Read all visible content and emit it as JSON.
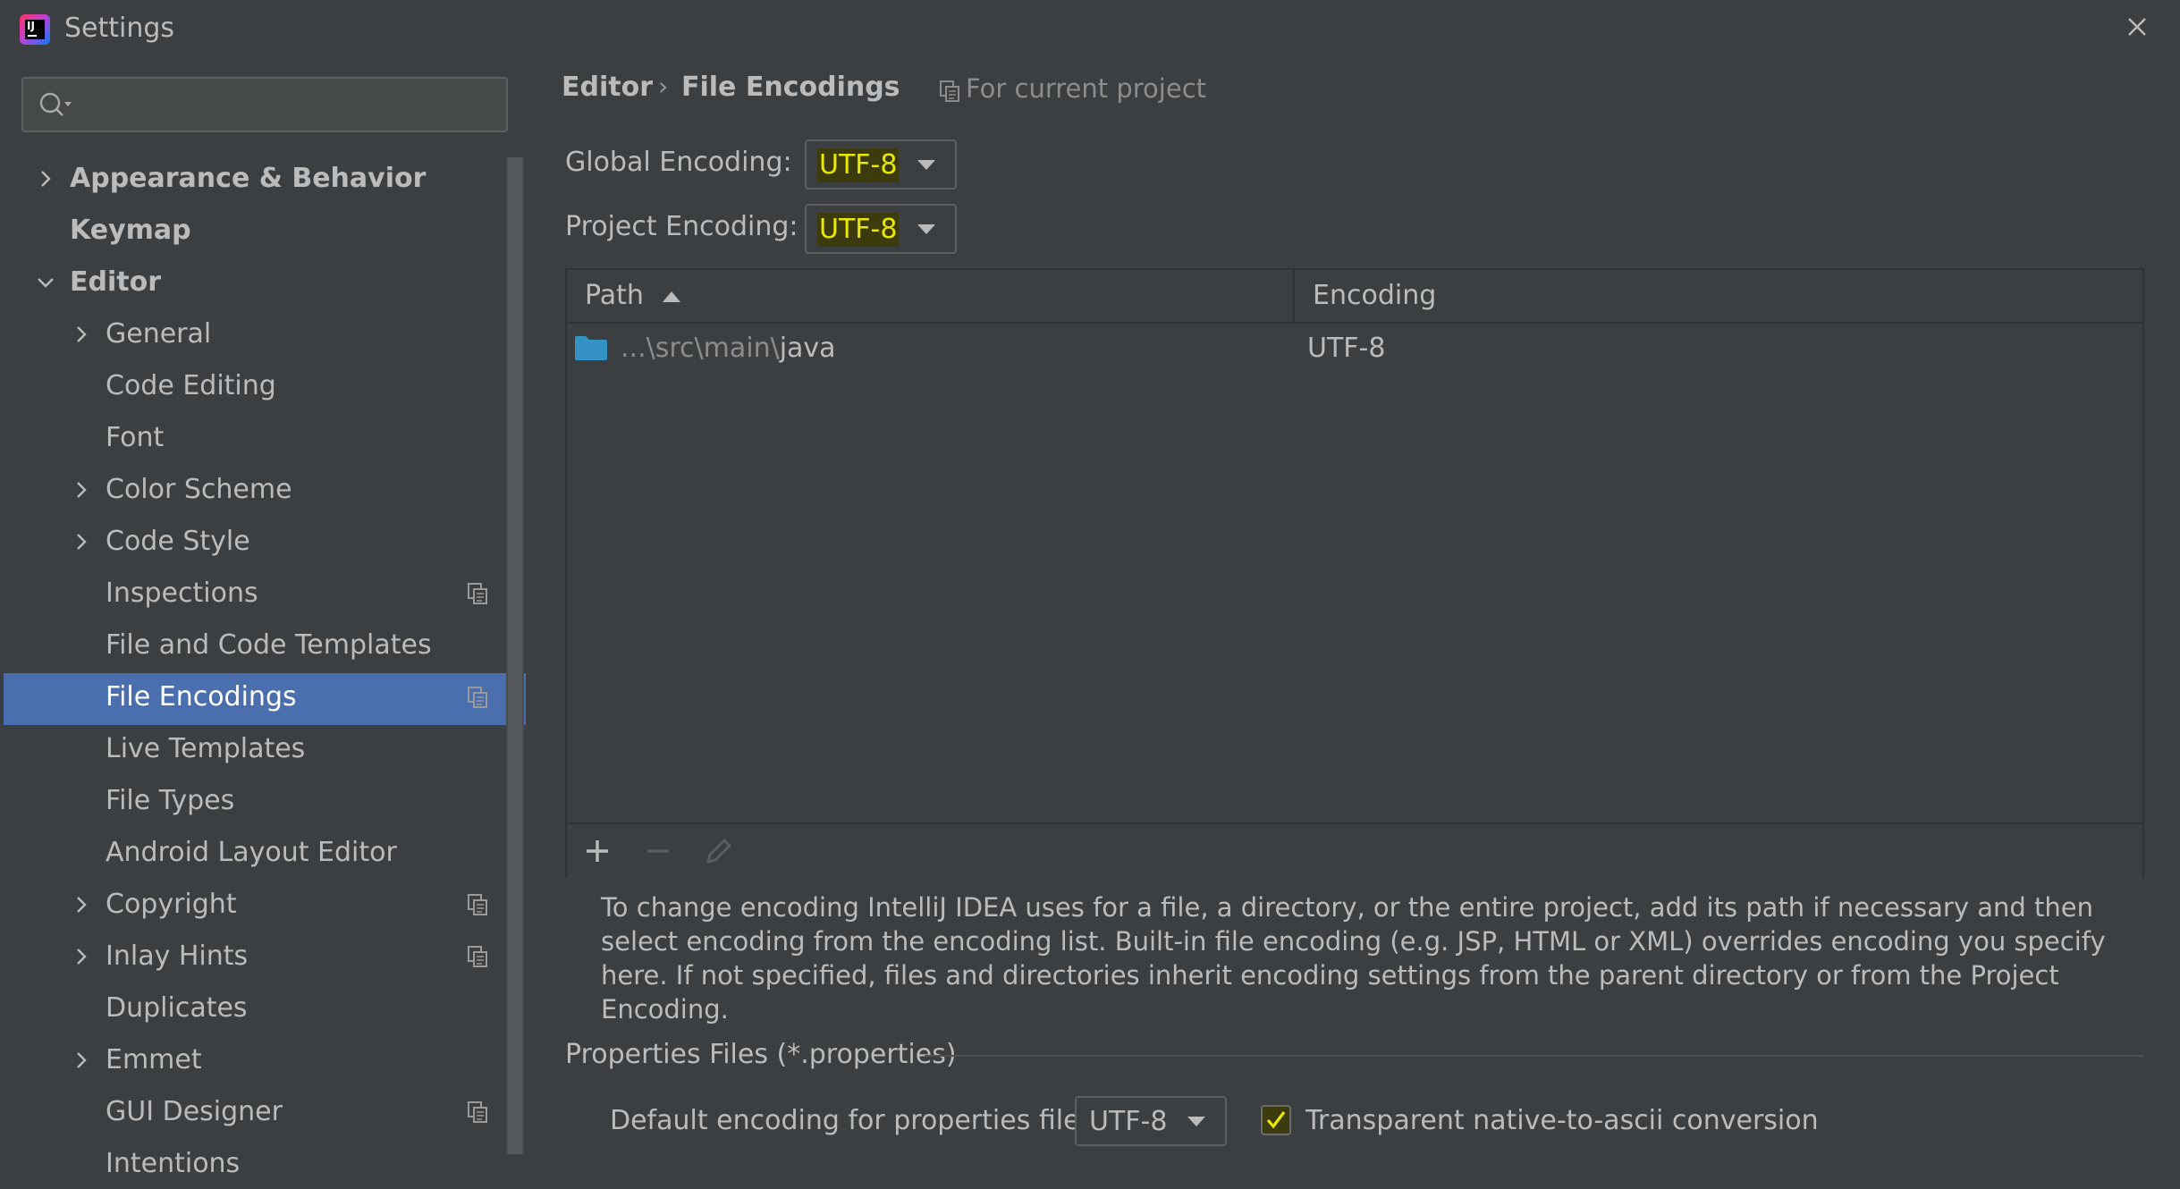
{
  "window": {
    "title": "Settings"
  },
  "sidebar": {
    "search": {
      "placeholder": "",
      "value": ""
    },
    "items": [
      {
        "label": "Appearance & Behavior",
        "level": 0,
        "expandable": true,
        "expanded": false,
        "bold": true,
        "shared": false,
        "selected": false
      },
      {
        "label": "Keymap",
        "level": 0,
        "expandable": false,
        "bold": true,
        "shared": false,
        "selected": false
      },
      {
        "label": "Editor",
        "level": 0,
        "expandable": true,
        "expanded": true,
        "bold": true,
        "shared": false,
        "selected": false
      },
      {
        "label": "General",
        "level": 1,
        "expandable": true,
        "expanded": false,
        "shared": false,
        "selected": false
      },
      {
        "label": "Code Editing",
        "level": 1,
        "expandable": false,
        "shared": false,
        "selected": false
      },
      {
        "label": "Font",
        "level": 1,
        "expandable": false,
        "shared": false,
        "selected": false
      },
      {
        "label": "Color Scheme",
        "level": 1,
        "expandable": true,
        "expanded": false,
        "shared": false,
        "selected": false
      },
      {
        "label": "Code Style",
        "level": 1,
        "expandable": true,
        "expanded": false,
        "shared": false,
        "selected": false
      },
      {
        "label": "Inspections",
        "level": 1,
        "expandable": false,
        "shared": true,
        "selected": false
      },
      {
        "label": "File and Code Templates",
        "level": 1,
        "expandable": false,
        "shared": false,
        "selected": false
      },
      {
        "label": "File Encodings",
        "level": 1,
        "expandable": false,
        "shared": true,
        "selected": true
      },
      {
        "label": "Live Templates",
        "level": 1,
        "expandable": false,
        "shared": false,
        "selected": false
      },
      {
        "label": "File Types",
        "level": 1,
        "expandable": false,
        "shared": false,
        "selected": false
      },
      {
        "label": "Android Layout Editor",
        "level": 1,
        "expandable": false,
        "shared": false,
        "selected": false
      },
      {
        "label": "Copyright",
        "level": 1,
        "expandable": true,
        "expanded": false,
        "shared": true,
        "selected": false
      },
      {
        "label": "Inlay Hints",
        "level": 1,
        "expandable": true,
        "expanded": false,
        "shared": true,
        "selected": false
      },
      {
        "label": "Duplicates",
        "level": 1,
        "expandable": false,
        "shared": false,
        "selected": false
      },
      {
        "label": "Emmet",
        "level": 1,
        "expandable": true,
        "expanded": false,
        "shared": false,
        "selected": false
      },
      {
        "label": "GUI Designer",
        "level": 1,
        "expandable": false,
        "shared": true,
        "selected": false
      },
      {
        "label": "Intentions",
        "level": 1,
        "expandable": false,
        "shared": false,
        "selected": false
      }
    ]
  },
  "breadcrumb": {
    "parent": "Editor",
    "separator": "›",
    "current": "File Encodings"
  },
  "scope": {
    "label": "For current project",
    "icon": "copy-icon"
  },
  "global_encoding": {
    "label": "Global Encoding:",
    "value": "UTF-8"
  },
  "project_encoding": {
    "label": "Project Encoding:",
    "value": "UTF-8"
  },
  "table": {
    "columns": [
      "Path",
      "Encoding"
    ],
    "sort": {
      "column": "Path",
      "direction": "ascending"
    },
    "rows": [
      {
        "path_prefix": "...\\src\\main\\",
        "path_name": "java",
        "encoding": "UTF-8",
        "icon": "folder-icon"
      }
    ]
  },
  "toolbar": {
    "add_icon": "plus-icon",
    "remove_icon": "minus-icon",
    "edit_icon": "pencil-icon"
  },
  "help_text": "To change encoding IntelliJ IDEA uses for a file, a directory, or the entire project, add its path if necessary and then select encoding from the encoding list. Built-in file encoding (e.g. JSP, HTML or XML) overrides encoding you specify here. If not specified, files and directories inherit encoding settings from the parent directory or from the Project Encoding.",
  "properties": {
    "section_title": "Properties Files (*.properties)",
    "default_label": "Default encoding for properties files:",
    "default_value": "UTF-8",
    "transparent_label": "Transparent native-to-ascii conversion",
    "transparent_checked": true
  },
  "colors": {
    "background": "#3c3f41",
    "selection": "#4b6eaf",
    "text": "#bbbbbb",
    "highlight_text": "#e8e800",
    "highlight_bg": "#3b3b0d",
    "folder": "#3592c4"
  }
}
